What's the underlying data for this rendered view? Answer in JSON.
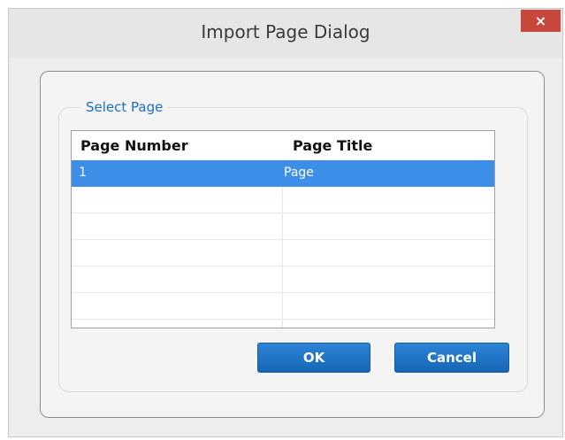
{
  "window": {
    "title": "Import Page Dialog",
    "close_label": "×"
  },
  "group": {
    "legend": "Select Page"
  },
  "grid": {
    "columns": [
      "Page Number",
      "Page Title"
    ],
    "rows": [
      {
        "page_number": "1",
        "page_title": "Page",
        "selected": true
      },
      {
        "page_number": "",
        "page_title": ""
      },
      {
        "page_number": "",
        "page_title": ""
      },
      {
        "page_number": "",
        "page_title": ""
      },
      {
        "page_number": "",
        "page_title": ""
      },
      {
        "page_number": "",
        "page_title": ""
      }
    ]
  },
  "buttons": {
    "ok": "OK",
    "cancel": "Cancel"
  },
  "colors": {
    "accent": "#3d8ee6",
    "close": "#c7473d",
    "legend": "#1a6fc0"
  }
}
